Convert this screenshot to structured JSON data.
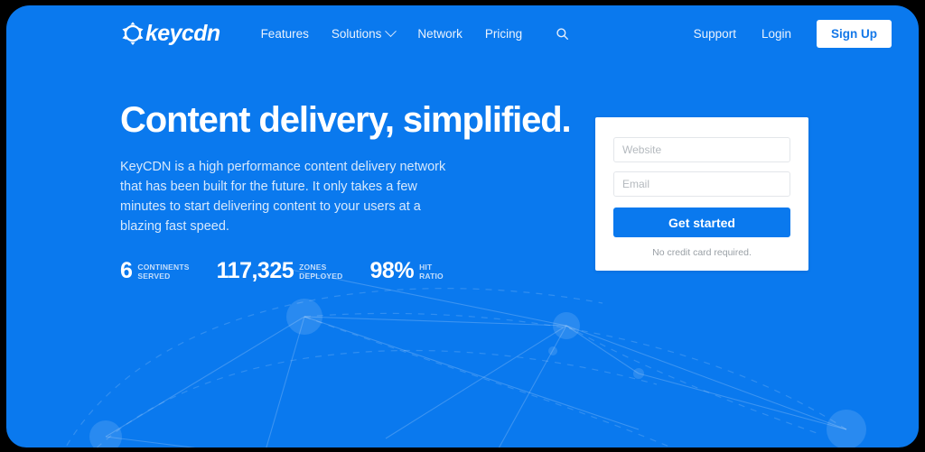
{
  "brand": {
    "name": "keycdn",
    "logo_icon": "keycdn-wheel-icon",
    "accent_color": "#0a79ee",
    "background_color": "#0a79ee",
    "frame_color": "#000000"
  },
  "nav": {
    "items": [
      {
        "label": "Features",
        "has_dropdown": false
      },
      {
        "label": "Solutions",
        "has_dropdown": true
      },
      {
        "label": "Network",
        "has_dropdown": false
      },
      {
        "label": "Pricing",
        "has_dropdown": false
      }
    ],
    "search_icon": "search-icon",
    "chevron_icon": "chevron-down-icon",
    "right": {
      "support_label": "Support",
      "login_label": "Login",
      "signup_label": "Sign Up"
    }
  },
  "hero": {
    "title": "Content delivery, simplified.",
    "subtitle": "KeyCDN is a high performance content delivery network that has been built for the future. It only takes a few minutes to start delivering content to your users at a blazing fast speed.",
    "stats": [
      {
        "value": "6",
        "label_line1": "CONTINENTS",
        "label_line2": "SERVED"
      },
      {
        "value": "117,325",
        "label_line1": "ZONES",
        "label_line2": "DEPLOYED"
      },
      {
        "value": "98%",
        "label_line1": "HIT",
        "label_line2": "RATIO"
      }
    ]
  },
  "signup_form": {
    "website_value": "",
    "website_placeholder": "Website",
    "email_value": "",
    "email_placeholder": "Email",
    "submit_label": "Get started",
    "fineprint": "No credit card required."
  }
}
